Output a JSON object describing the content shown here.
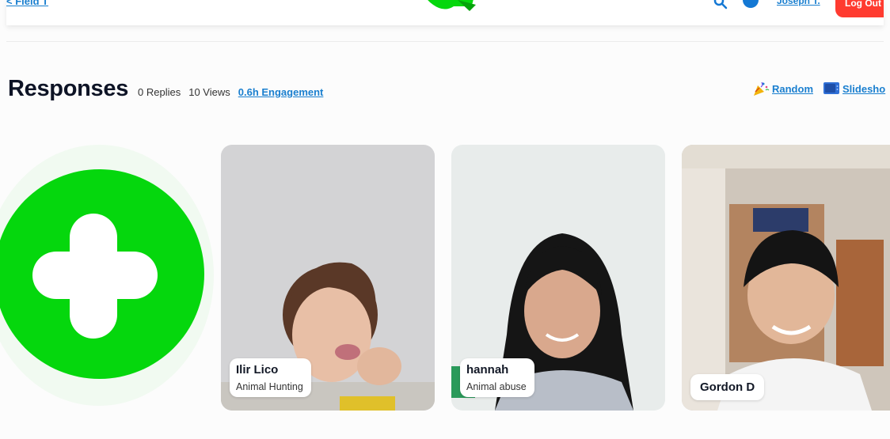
{
  "topbar": {
    "back_link": "< Field T",
    "user_link": "Joseph T.",
    "red_button": "Log Out"
  },
  "header": {
    "title": "Responses",
    "replies": "0 Replies",
    "views": "10 Views",
    "engagement": "0.6h Engagement"
  },
  "actions": {
    "random": "Random",
    "slideshow": "Slidesho"
  },
  "colors": {
    "brand_green": "#05d70d",
    "link_blue": "#1a7fcf",
    "alert_red": "#ff3b30"
  },
  "cards": [
    {
      "name": "Ilir Lico",
      "topic": "Animal Hunting"
    },
    {
      "name": "hannah",
      "topic": "Animal abuse"
    },
    {
      "name": "Gordon D",
      "topic": ""
    }
  ]
}
